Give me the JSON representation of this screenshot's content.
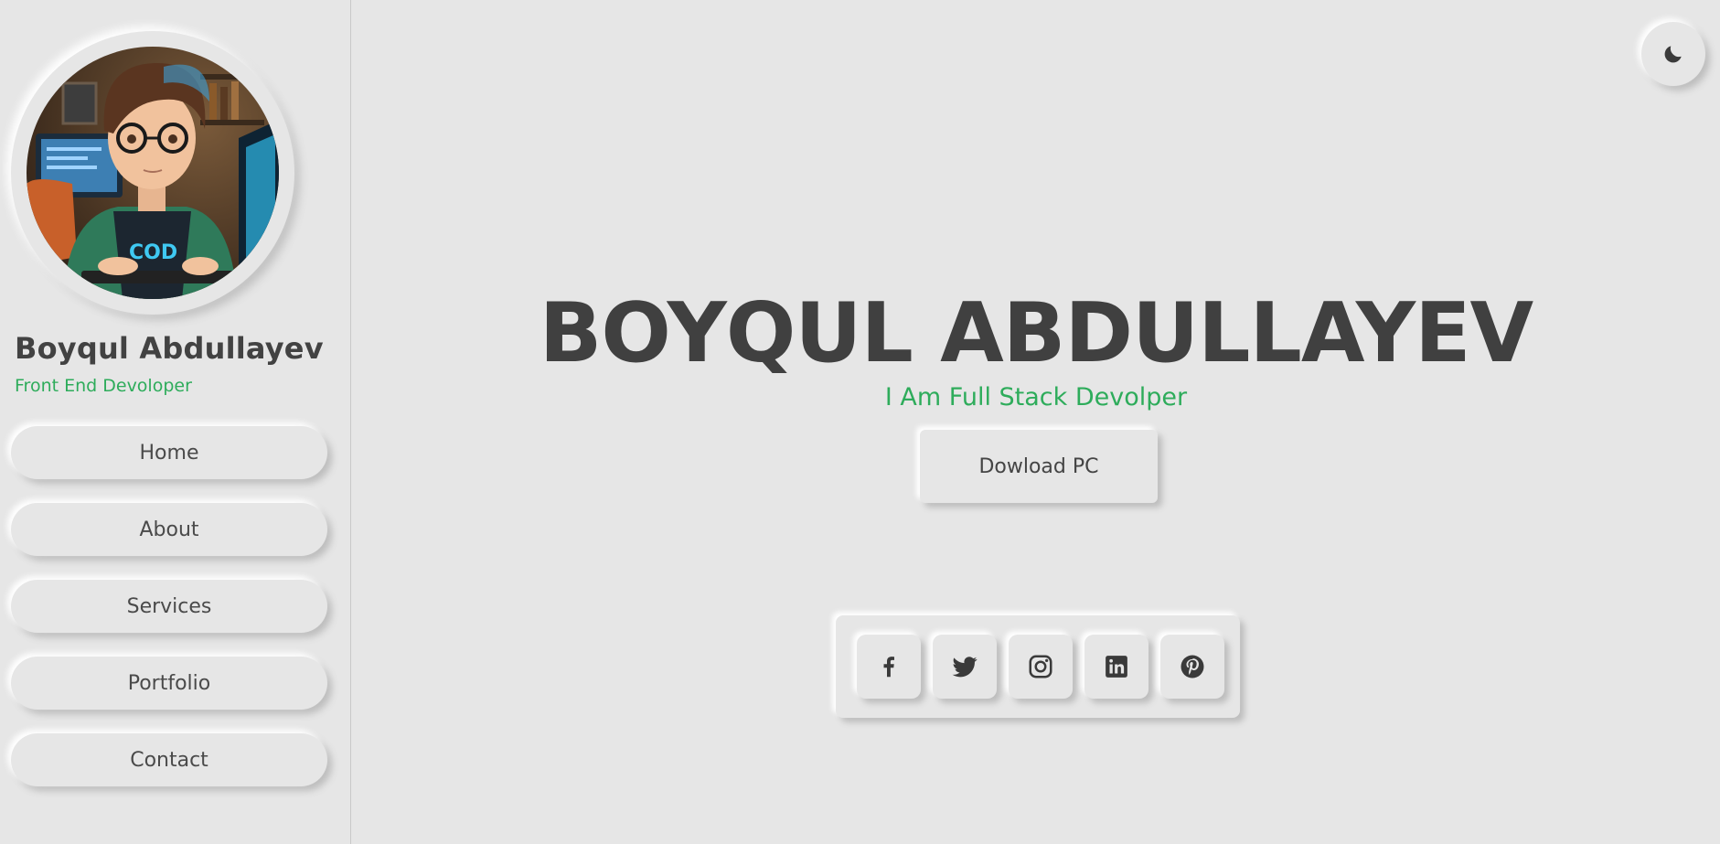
{
  "profile": {
    "name": "Boyqul Abdullayev",
    "role": "Front End Devoloper"
  },
  "nav": {
    "items": [
      {
        "label": "Home"
      },
      {
        "label": "About"
      },
      {
        "label": "Services"
      },
      {
        "label": "Portfolio"
      },
      {
        "label": "Contact"
      }
    ]
  },
  "theme_toggle": {
    "icon": "moon-icon"
  },
  "hero": {
    "title": "BOYQUL ABDULLAYEV",
    "subtitle": "I Am Full Stack Devolper",
    "download_label": "Dowload PC"
  },
  "social": {
    "icons": [
      "facebook-icon",
      "twitter-icon",
      "instagram-icon",
      "linkedin-icon",
      "pinterest-icon"
    ]
  },
  "colors": {
    "background": "#e6e6e6",
    "accent": "#2eac5b",
    "text": "#444444"
  }
}
